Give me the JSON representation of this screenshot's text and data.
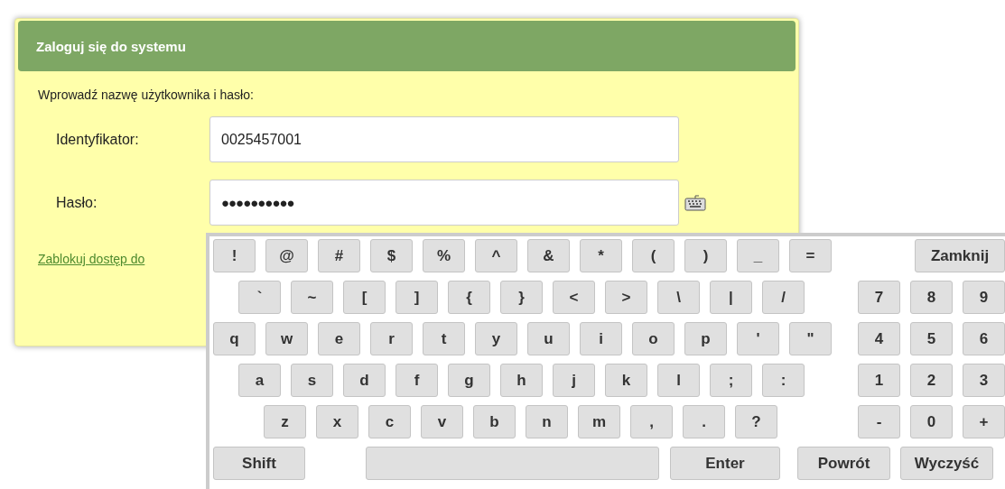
{
  "login": {
    "title": "Zaloguj się do systemu",
    "prompt": "Wprowadź nazwę użytkownika i hasło:",
    "fields": [
      {
        "kind": "text",
        "label": "Identyfikator:",
        "value": "0025457001"
      },
      {
        "kind": "password",
        "label": "Hasło:",
        "value": "●●●●●●●●●●"
      }
    ],
    "link": "Zablokuj dostęp do"
  },
  "keyboard": {
    "rows": [
      {
        "keys": [
          "!",
          "@",
          "#",
          "$",
          "%",
          "^",
          "&",
          "*",
          "(",
          ")",
          "_",
          "="
        ],
        "numpad": [
          {
            "kind": "close",
            "label": "Zamknij"
          }
        ]
      },
      {
        "keys": [
          "`",
          "~",
          "[",
          "]",
          "{",
          "}",
          "<",
          ">",
          "\\",
          "|",
          "/"
        ],
        "numpad": [
          {
            "kind": "char",
            "label": "7"
          },
          {
            "kind": "char",
            "label": "8"
          },
          {
            "kind": "char",
            "label": "9"
          }
        ]
      },
      {
        "keys": [
          "q",
          "w",
          "e",
          "r",
          "t",
          "y",
          "u",
          "i",
          "o",
          "p",
          "'",
          "\""
        ],
        "numpad": [
          {
            "kind": "char",
            "label": "4"
          },
          {
            "kind": "char",
            "label": "5"
          },
          {
            "kind": "char",
            "label": "6"
          }
        ]
      },
      {
        "keys": [
          "a",
          "s",
          "d",
          "f",
          "g",
          "h",
          "j",
          "k",
          "l",
          ";",
          ":"
        ],
        "numpad": [
          {
            "kind": "char",
            "label": "1"
          },
          {
            "kind": "char",
            "label": "2"
          },
          {
            "kind": "char",
            "label": "3"
          }
        ]
      },
      {
        "keys": [
          "z",
          "x",
          "c",
          "v",
          "b",
          "n",
          "m",
          ",",
          ".",
          "?"
        ],
        "numpad": [
          {
            "kind": "char",
            "label": "-"
          },
          {
            "kind": "char",
            "label": "0"
          },
          {
            "kind": "char",
            "label": "+"
          }
        ]
      }
    ],
    "bottom_keys": [
      {
        "kind": "shift",
        "label": "Shift"
      },
      {
        "kind": "space"
      },
      {
        "kind": "enter",
        "label": "Enter"
      },
      {
        "kind": "back",
        "label": "Powrót"
      },
      {
        "kind": "clear",
        "label": "Wyczyść"
      }
    ]
  }
}
